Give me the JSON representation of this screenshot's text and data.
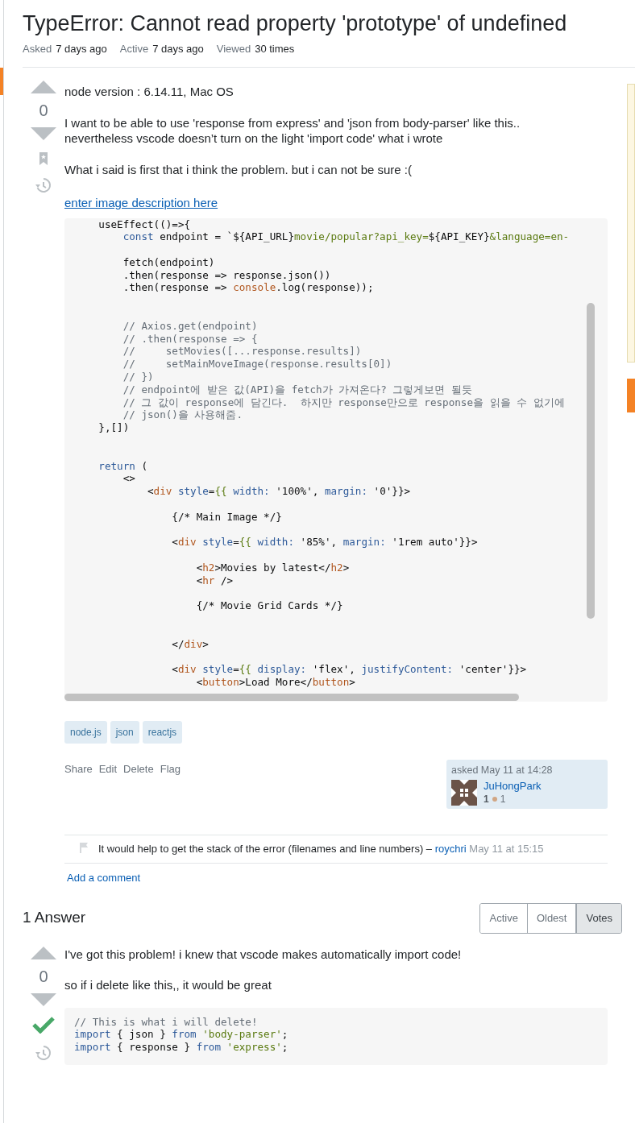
{
  "question": {
    "title": "TypeError: Cannot read property 'prototype' of undefined",
    "meta": [
      {
        "label": "Asked",
        "value": "7 days ago"
      },
      {
        "label": "Active",
        "value": "7 days ago"
      },
      {
        "label": "Viewed",
        "value": "30 times"
      }
    ],
    "votes": "0",
    "paragraphs": [
      "node version : 6.14.11, Mac OS",
      "I want to be able to use 'response from express' and 'json from body-parser' like this..\nnevertheless vscode doesn’t turn on the light 'import code' what i wrote",
      "What i said is first that i think the problem. but i can not be sure :("
    ],
    "image_link": "enter image description here",
    "code": [
      {
        "segs": [
          {
            "t": "    useEffect(()=>{",
            "kind": "plain"
          }
        ]
      },
      {
        "segs": [
          {
            "t": "        const",
            "kind": "keyword"
          },
          {
            "t": " endpoint = `${API_URL}",
            "kind": "plain"
          },
          {
            "t": "movie/popular?api_key=",
            "kind": "string"
          },
          {
            "t": "${API_KEY}",
            "kind": "plain"
          },
          {
            "t": "&language=en-",
            "kind": "string"
          }
        ]
      },
      {
        "blank": true
      },
      {
        "segs": [
          {
            "t": "        fetch(endpoint)",
            "kind": "plain"
          }
        ]
      },
      {
        "segs": [
          {
            "t": "        .then(response => response.json())",
            "kind": "plain"
          }
        ]
      },
      {
        "segs": [
          {
            "t": "        .then(response => ",
            "kind": "plain"
          },
          {
            "t": "console",
            "kind": "tag"
          },
          {
            "t": ".log(response));",
            "kind": "plain"
          }
        ]
      },
      {
        "blank": true
      },
      {
        "blank": true
      },
      {
        "segs": [
          {
            "t": "        // Axios.get(endpoint)",
            "kind": "comment"
          }
        ]
      },
      {
        "segs": [
          {
            "t": "        // .then(response => {",
            "kind": "comment"
          }
        ]
      },
      {
        "segs": [
          {
            "t": "        //     setMovies([...response.results])",
            "kind": "comment"
          }
        ]
      },
      {
        "segs": [
          {
            "t": "        //     setMainMoveImage(response.results[0])",
            "kind": "comment"
          }
        ]
      },
      {
        "segs": [
          {
            "t": "        // })",
            "kind": "comment"
          }
        ]
      },
      {
        "segs": [
          {
            "t": "        // endpoint에 받은 값(API)을 fetch가 가져온다? 그렇게보면 될듯",
            "kind": "comment"
          }
        ]
      },
      {
        "segs": [
          {
            "t": "        // 그 값이 response에 담긴다.  하지만 response만으로 response을 읽을 수 없기에",
            "kind": "comment"
          }
        ]
      },
      {
        "segs": [
          {
            "t": "        // json()을 사용해줌.",
            "kind": "comment"
          }
        ]
      },
      {
        "segs": [
          {
            "t": "    },[])",
            "kind": "plain"
          }
        ]
      },
      {
        "blank": true
      },
      {
        "blank": true
      },
      {
        "segs": [
          {
            "t": "    return",
            "kind": "keyword"
          },
          {
            "t": " (",
            "kind": "plain"
          }
        ]
      },
      {
        "segs": [
          {
            "t": "        <>",
            "kind": "plain"
          }
        ]
      },
      {
        "segs": [
          {
            "t": "            <",
            "kind": "plain"
          },
          {
            "t": "div",
            "kind": "tag"
          },
          {
            "t": " style",
            "kind": "attr"
          },
          {
            "t": "=",
            "kind": "plain"
          },
          {
            "t": "{{",
            "kind": "string"
          },
          {
            "t": " width:",
            "kind": "attr"
          },
          {
            "t": " '100%', ",
            "kind": "plain"
          },
          {
            "t": "margin:",
            "kind": "attr"
          },
          {
            "t": " '0'}}>",
            "kind": "plain"
          }
        ]
      },
      {
        "blank": true
      },
      {
        "segs": [
          {
            "t": "                {/* Main Image */}",
            "kind": "plain"
          }
        ]
      },
      {
        "blank": true
      },
      {
        "segs": [
          {
            "t": "                <",
            "kind": "plain"
          },
          {
            "t": "div",
            "kind": "tag"
          },
          {
            "t": " style",
            "kind": "attr"
          },
          {
            "t": "=",
            "kind": "plain"
          },
          {
            "t": "{{",
            "kind": "string"
          },
          {
            "t": " width:",
            "kind": "attr"
          },
          {
            "t": " '85%', ",
            "kind": "plain"
          },
          {
            "t": "margin:",
            "kind": "attr"
          },
          {
            "t": " '1rem auto'}}>",
            "kind": "plain"
          }
        ]
      },
      {
        "blank": true
      },
      {
        "segs": [
          {
            "t": "                    <",
            "kind": "plain"
          },
          {
            "t": "h2",
            "kind": "tag"
          },
          {
            "t": ">Movies by latest</",
            "kind": "plain"
          },
          {
            "t": "h2",
            "kind": "tag"
          },
          {
            "t": ">",
            "kind": "plain"
          }
        ]
      },
      {
        "segs": [
          {
            "t": "                    <",
            "kind": "plain"
          },
          {
            "t": "hr",
            "kind": "tag"
          },
          {
            "t": " />",
            "kind": "plain"
          }
        ]
      },
      {
        "blank": true
      },
      {
        "segs": [
          {
            "t": "                    {/* Movie Grid Cards */}",
            "kind": "plain"
          }
        ]
      },
      {
        "blank": true
      },
      {
        "blank": true
      },
      {
        "segs": [
          {
            "t": "                </",
            "kind": "plain"
          },
          {
            "t": "div",
            "kind": "tag"
          },
          {
            "t": ">",
            "kind": "plain"
          }
        ]
      },
      {
        "blank": true
      },
      {
        "segs": [
          {
            "t": "                <",
            "kind": "plain"
          },
          {
            "t": "div",
            "kind": "tag"
          },
          {
            "t": " style",
            "kind": "attr"
          },
          {
            "t": "=",
            "kind": "plain"
          },
          {
            "t": "{{",
            "kind": "string"
          },
          {
            "t": " display:",
            "kind": "attr"
          },
          {
            "t": " 'flex', ",
            "kind": "plain"
          },
          {
            "t": "justifyContent:",
            "kind": "attr"
          },
          {
            "t": " 'center'}}>",
            "kind": "plain"
          }
        ]
      },
      {
        "segs": [
          {
            "t": "                    <",
            "kind": "plain"
          },
          {
            "t": "button",
            "kind": "tag"
          },
          {
            "t": ">Load More</",
            "kind": "plain"
          },
          {
            "t": "button",
            "kind": "tag"
          },
          {
            "t": ">",
            "kind": "plain"
          }
        ]
      }
    ],
    "tags": [
      "node.js",
      "json",
      "reactjs"
    ],
    "actions": [
      "Share",
      "Edit",
      "Delete",
      "Flag"
    ],
    "asked": {
      "label": "asked May 11 at 14:28",
      "user": "JuHongPark",
      "reputation": "1",
      "bronze": "1"
    },
    "comments": [
      {
        "text": "It would help to get the stack of the error (filenames and line numbers) –",
        "author": "roychri",
        "time": "May 11 at 15:15"
      }
    ],
    "add_comment": "Add a comment"
  },
  "answers_header": {
    "title": "1 Answer",
    "sort": [
      {
        "label": "Active",
        "selected": false
      },
      {
        "label": "Oldest",
        "selected": false
      },
      {
        "label": "Votes",
        "selected": true
      }
    ]
  },
  "answer": {
    "votes": "0",
    "accepted": true,
    "paragraphs": [
      "I've got this problem! i knew that vscode makes automatically import code!",
      "so if i delete like this,, it would be great"
    ],
    "code": [
      {
        "segs": [
          {
            "t": "// This is what i will delete!",
            "kind": "comment"
          }
        ]
      },
      {
        "segs": [
          {
            "t": "import",
            "kind": "keyword"
          },
          {
            "t": " { json } ",
            "kind": "plain"
          },
          {
            "t": "from",
            "kind": "keyword"
          },
          {
            "t": " 'body-parser'",
            "kind": "string"
          },
          {
            "t": ";",
            "kind": "plain"
          }
        ]
      },
      {
        "segs": [
          {
            "t": "import",
            "kind": "keyword"
          },
          {
            "t": " { response } ",
            "kind": "plain"
          },
          {
            "t": "from",
            "kind": "keyword"
          },
          {
            "t": " 'express'",
            "kind": "string"
          },
          {
            "t": ";",
            "kind": "plain"
          }
        ]
      }
    ]
  }
}
